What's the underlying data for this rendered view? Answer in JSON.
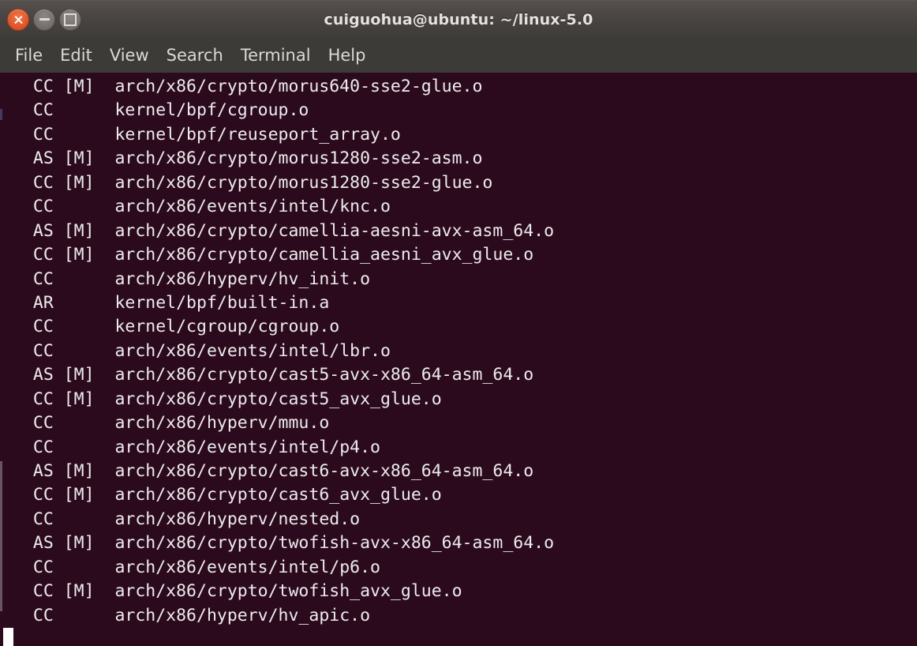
{
  "window": {
    "title": "cuiguohua@ubuntu: ~/linux-5.0",
    "controls": [
      {
        "name": "close",
        "label": "Close",
        "glyph": "x",
        "color": "#e0572b"
      },
      {
        "name": "minimize",
        "label": "Minimize",
        "glyph": "dash",
        "color": "#77716e"
      },
      {
        "name": "maximize",
        "label": "Maximize",
        "glyph": "sq",
        "color": "#77716e"
      }
    ]
  },
  "menubar": {
    "items": [
      {
        "label": "File"
      },
      {
        "label": "Edit"
      },
      {
        "label": "View"
      },
      {
        "label": "Search"
      },
      {
        "label": "Terminal"
      },
      {
        "label": "Help"
      }
    ]
  },
  "terminal": {
    "background_color": "#2C0A1E",
    "foreground_color": "#ECECEC",
    "cursor_color": "#FFFFFF",
    "cursor_visible": true,
    "lines": [
      "  CC [M]  arch/x86/crypto/morus640-sse2-glue.o",
      "  CC      kernel/bpf/cgroup.o",
      "  CC      kernel/bpf/reuseport_array.o",
      "  AS [M]  arch/x86/crypto/morus1280-sse2-asm.o",
      "  CC [M]  arch/x86/crypto/morus1280-sse2-glue.o",
      "  CC      arch/x86/events/intel/knc.o",
      "  AS [M]  arch/x86/crypto/camellia-aesni-avx-asm_64.o",
      "  CC [M]  arch/x86/crypto/camellia_aesni_avx_glue.o",
      "  CC      arch/x86/hyperv/hv_init.o",
      "  AR      kernel/bpf/built-in.a",
      "  CC      kernel/cgroup/cgroup.o",
      "  CC      arch/x86/events/intel/lbr.o",
      "  AS [M]  arch/x86/crypto/cast5-avx-x86_64-asm_64.o",
      "  CC [M]  arch/x86/crypto/cast5_avx_glue.o",
      "  CC      arch/x86/hyperv/mmu.o",
      "  CC      arch/x86/events/intel/p4.o",
      "  AS [M]  arch/x86/crypto/cast6-avx-x86_64-asm_64.o",
      "  CC [M]  arch/x86/crypto/cast6_avx_glue.o",
      "  CC      arch/x86/hyperv/nested.o",
      "  AS [M]  arch/x86/crypto/twofish-avx-x86_64-asm_64.o",
      "  CC      arch/x86/events/intel/p6.o",
      "  CC [M]  arch/x86/crypto/twofish_avx_glue.o",
      "  CC      arch/x86/hyperv/hv_apic.o"
    ]
  }
}
